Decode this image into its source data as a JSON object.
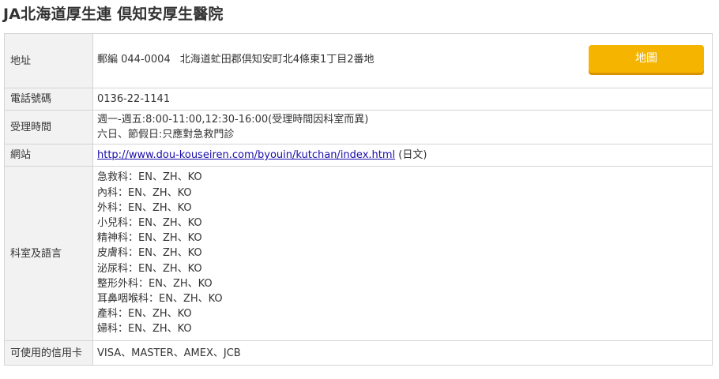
{
  "page": {
    "title": "JA北海道厚生連 倶知安厚生醫院"
  },
  "address": {
    "label": "地址",
    "postal": "郵編 044-0004",
    "street": "北海道虻田郡倶知安町北4條東1丁目2番地",
    "map_button_label": "地圖"
  },
  "phone": {
    "label": "電話號碼",
    "value": "0136-22-1141"
  },
  "hours": {
    "label": "受理時間",
    "lines": [
      "週一-週五:8:00-11:00,12:30-16:00(受理時間因科室而異)",
      "六日、節假日:只應對急救門診"
    ]
  },
  "website": {
    "label": "網站",
    "url": "http://www.dou-kouseiren.com/byouin/kutchan/index.html",
    "suffix": "(日文)"
  },
  "departments": {
    "label": "科室及語言",
    "items": [
      "急救科：EN、ZH、KO",
      "內科：EN、ZH、KO",
      "外科：EN、ZH、KO",
      "小兒科：EN、ZH、KO",
      "精神科：EN、ZH、KO",
      "皮膚科：EN、ZH、KO",
      "泌尿科：EN、ZH、KO",
      "整形外科：EN、ZH、KO",
      "耳鼻咽喉科：EN、ZH、KO",
      "產科：EN、ZH、KO",
      "婦科：EN、ZH、KO"
    ]
  },
  "cards": {
    "label": "可使用的信用卡",
    "value": "VISA、MASTER、AMEX、JCB"
  },
  "colors": {
    "accent_button": "#f5b400",
    "label_background": "#f2f2f2",
    "border": "#d4d4d4",
    "link": "#1a0dab"
  }
}
